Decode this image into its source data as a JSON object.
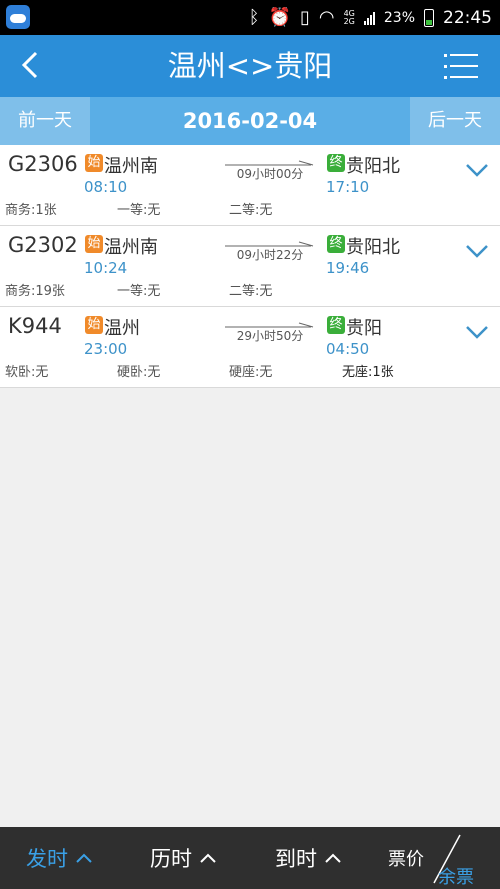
{
  "status_bar": {
    "network_top": "4G",
    "network_bottom": "2G",
    "battery": "23%",
    "time": "22:45"
  },
  "header": {
    "title": "温州<>贵阳"
  },
  "date_bar": {
    "prev_label": "前一天",
    "date": "2016-02-04",
    "next_label": "后一天"
  },
  "trains": [
    {
      "code": "G2306",
      "start_tag": "始",
      "from": "温州南",
      "dep_time": "08:10",
      "duration": "09小时00分",
      "end_tag": "终",
      "to": "贵阳北",
      "arr_time": "17:10",
      "seats": [
        "商务:1张",
        "一等:无",
        "二等:无",
        ""
      ]
    },
    {
      "code": "G2302",
      "start_tag": "始",
      "from": "温州南",
      "dep_time": "10:24",
      "duration": "09小时22分",
      "end_tag": "终",
      "to": "贵阳北",
      "arr_time": "19:46",
      "seats": [
        "商务:19张",
        "一等:无",
        "二等:无",
        ""
      ]
    },
    {
      "code": "K944",
      "start_tag": "始",
      "from": "温州",
      "dep_time": "23:00",
      "duration": "29小时50分",
      "end_tag": "终",
      "to": "贵阳",
      "arr_time": "04:50",
      "seats": [
        "软卧:无",
        "硬卧:无",
        "硬座:无",
        "无座:1张"
      ]
    }
  ],
  "bottom_bar": {
    "sort_departure": "发时",
    "sort_duration": "历时",
    "sort_arrival": "到时",
    "price_label": "票价",
    "remaining_label": "余票"
  },
  "colors": {
    "header_bg": "#2b8ed8",
    "date_bar_bg": "#5aaee6",
    "accent_blue": "#3aa0e6",
    "start_tag": "#f08a2a",
    "end_tag": "#3aae3a"
  }
}
